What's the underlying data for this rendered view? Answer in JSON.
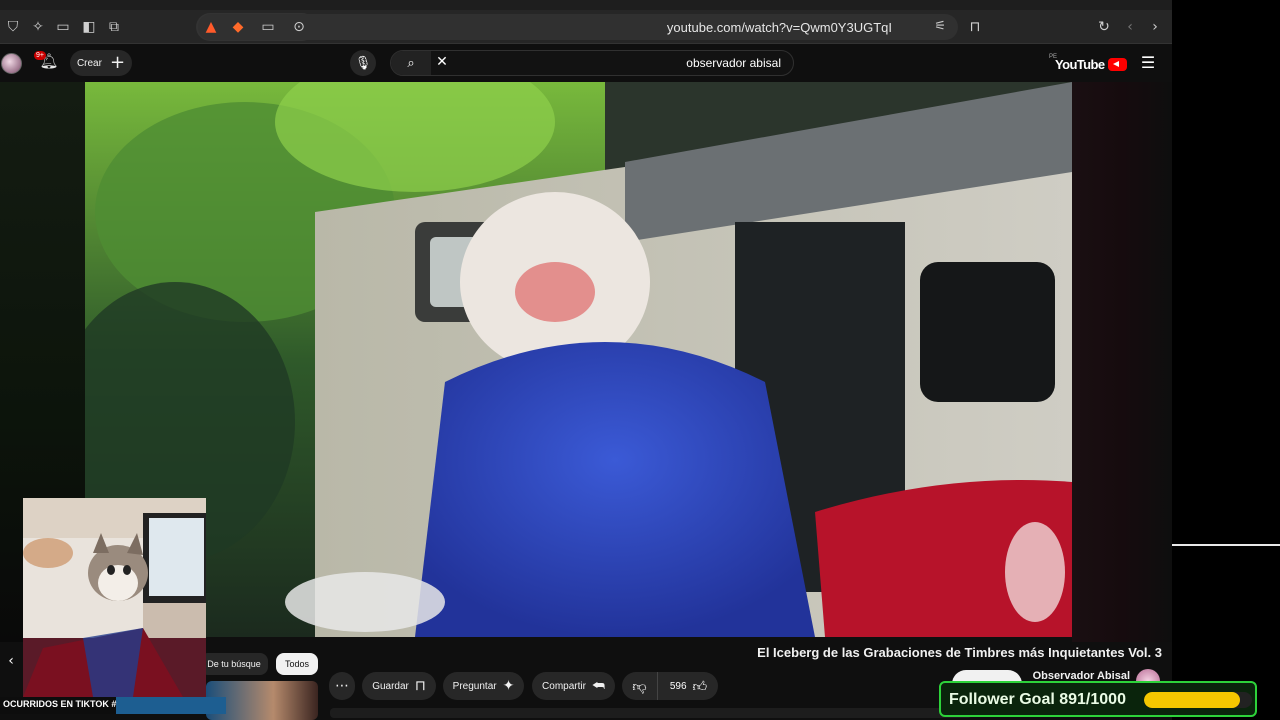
{
  "browser": {
    "url": "youtube.com/watch?v=Qwm0Y3UGTqI",
    "toolbar_icons": [
      "shield-icon",
      "extension-icon",
      "tab-icon",
      "sidebar-icon",
      "tab-search-icon",
      "brave-icon",
      "bat-icon",
      "cast-icon",
      "lens-icon",
      "tune-icon",
      "bookmark-icon",
      "reload-icon",
      "back-icon",
      "forward-icon"
    ]
  },
  "header": {
    "create_label": "Crear",
    "notification_count": "9+",
    "search_value": "observador abisal",
    "logo_text": "YouTube",
    "logo_region": "PE"
  },
  "video": {
    "title": "El Iceberg de las Grabaciones de Timbres más Inquietantes Vol. 3",
    "channel": "Observador Abisal",
    "likes": "596",
    "actions": {
      "share": "Compartir",
      "ask": "Preguntar",
      "save": "Guardar"
    }
  },
  "chips": {
    "all": "Todos",
    "from_search": "De tu búsque"
  },
  "overlay": {
    "tiktok_text": "OCURRIDOS EN TIKTOK #",
    "goal_label": "Follower Goal 891/1000",
    "goal_fraction": 0.891,
    "goal_color": "#f5c700",
    "goal_border": "#2dd23a"
  }
}
